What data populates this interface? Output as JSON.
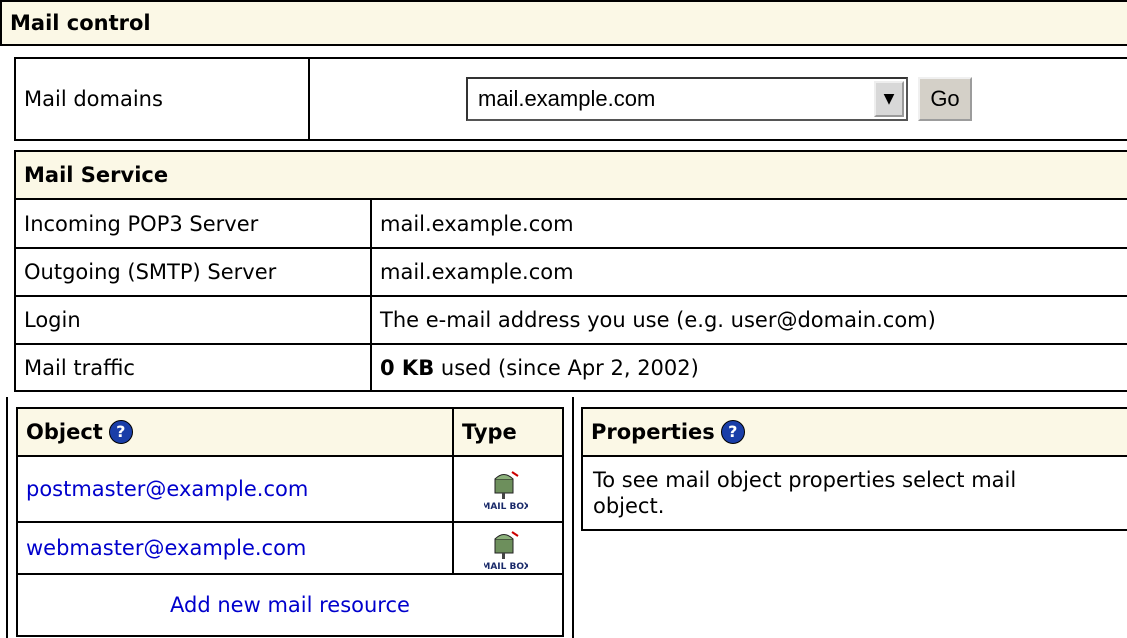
{
  "mail_control": {
    "title": "Mail control",
    "domains_label": "Mail domains",
    "domain_selected": "mail.example.com",
    "go_label": "Go"
  },
  "mail_service": {
    "title": "Mail Service",
    "rows": [
      {
        "label": "Incoming POP3 Server",
        "value": "mail.example.com"
      },
      {
        "label": "Outgoing (SMTP) Server",
        "value": "mail.example.com"
      },
      {
        "label": "Login",
        "value": "The e-mail address you use (e.g. user@domain.com)"
      },
      {
        "label": "Mail traffic",
        "value_bold": "0 KB",
        "value_rest": " used (since Apr 2, 2002)"
      }
    ]
  },
  "objects": {
    "col_object": "Object",
    "col_type": "Type",
    "items": [
      {
        "address": "postmaster@example.com",
        "type_icon": "mailbox-icon",
        "type_label": "MAIL BOX"
      },
      {
        "address": "webmaster@example.com",
        "type_icon": "mailbox-icon",
        "type_label": "MAIL BOX"
      }
    ],
    "add_link": "Add new mail resource"
  },
  "properties": {
    "title": "Properties",
    "message": "To see mail object properties select mail object."
  },
  "help_icon_glyph": "?",
  "colors": {
    "header_bg": "#fbf8e6",
    "link": "#0000cc",
    "help": "#1a3ea8"
  }
}
